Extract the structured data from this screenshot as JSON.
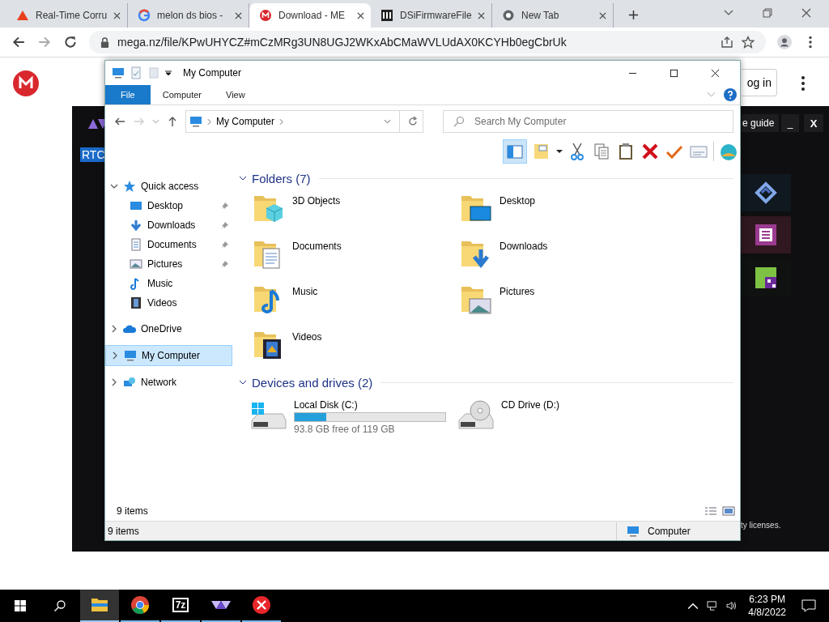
{
  "browser": {
    "tabs": [
      {
        "title": "Real-Time Corru",
        "selected": false
      },
      {
        "title": "melon ds bios -",
        "selected": false
      },
      {
        "title": "Download - ME",
        "selected": true
      },
      {
        "title": "DSiFirmwareFile",
        "selected": false
      },
      {
        "title": "New Tab",
        "selected": false
      }
    ],
    "url": "mega.nz/file/KPwUHYCZ#mCzMRg3UN8UGJ2WKxAbCMaWVLUdAX0KCYHb0egCbrUk"
  },
  "page": {
    "login_button": "og in"
  },
  "rtc": {
    "badge": "RTC",
    "guide_button": "e guide",
    "minimize": "_",
    "close": "X",
    "licenses": "ty licenses."
  },
  "explorer": {
    "title": "My Computer",
    "ribbon_tabs": [
      {
        "label": "File",
        "selected": true
      },
      {
        "label": "Computer",
        "selected": false
      },
      {
        "label": "View",
        "selected": false
      }
    ],
    "address": "My Computer",
    "search": {
      "placeholder": "Search My Computer"
    },
    "nav": [
      {
        "label": "Quick access",
        "expanded": true,
        "selected": false,
        "children": [
          {
            "label": "Desktop",
            "pinned": true,
            "selected": false
          },
          {
            "label": "Downloads",
            "pinned": true,
            "selected": false
          },
          {
            "label": "Documents",
            "pinned": true,
            "selected": false
          },
          {
            "label": "Pictures",
            "pinned": true,
            "selected": false
          },
          {
            "label": "Music",
            "pinned": false,
            "selected": false
          },
          {
            "label": "Videos",
            "pinned": false,
            "selected": false
          }
        ]
      },
      {
        "label": "OneDrive",
        "expanded": false,
        "selected": false
      },
      {
        "label": "My Computer",
        "expanded": false,
        "selected": true
      },
      {
        "label": "Network",
        "expanded": false,
        "selected": false
      }
    ],
    "folders": {
      "heading": "Folders (7)",
      "items": [
        "3D Objects",
        "Desktop",
        "Documents",
        "Downloads",
        "Music",
        "Pictures",
        "Videos"
      ]
    },
    "drives": {
      "heading": "Devices and drives (2)",
      "items": [
        {
          "kind": "disk",
          "name": "Local Disk (C:)",
          "level": 0.21,
          "free": "93.8 GB free of 119 GB"
        },
        {
          "kind": "optical",
          "name": "CD Drive (D:)"
        }
      ]
    },
    "item_count": "9 items",
    "status_bar": {
      "count": "9 items",
      "location": "Computer"
    }
  },
  "taskbar": {
    "apps": [
      {
        "kind": "explorer",
        "selected": true
      },
      {
        "kind": "chrome",
        "selected": false
      },
      {
        "kind": "archiver",
        "selected": false,
        "label": "7z"
      },
      {
        "kind": "rtc",
        "selected": false
      },
      {
        "kind": "error",
        "selected": false
      }
    ],
    "time": "6:23 PM",
    "date": "4/8/2022"
  }
}
